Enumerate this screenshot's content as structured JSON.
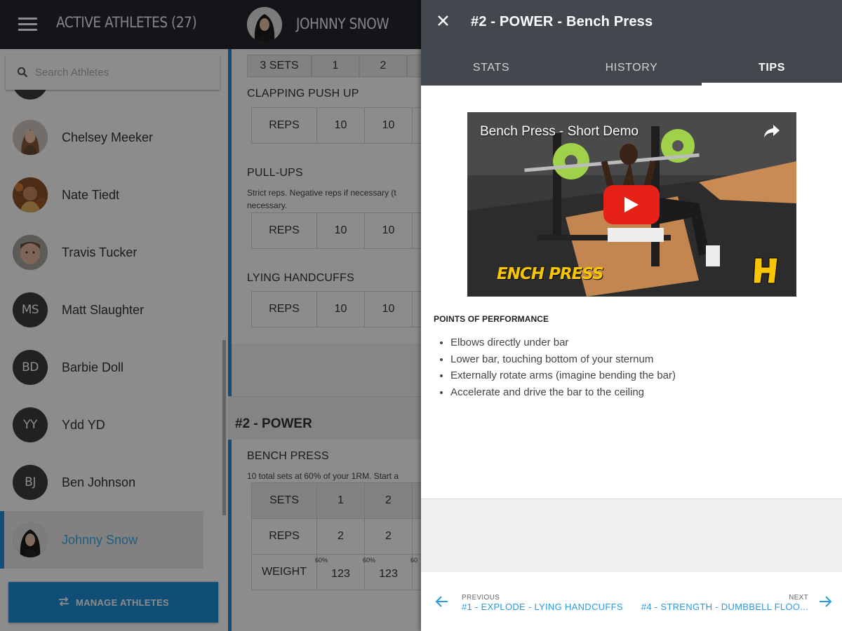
{
  "sidebar": {
    "title": "ACTIVE ATHLETES (27)",
    "search_placeholder": "Search Athletes",
    "athletes": [
      {
        "name": "Chelsey Meeker",
        "avatar": "photo",
        "initials": ""
      },
      {
        "name": "Nate Tiedt",
        "avatar": "photo",
        "initials": ""
      },
      {
        "name": "Travis Tucker",
        "avatar": "photo",
        "initials": ""
      },
      {
        "name": "Matt Slaughter",
        "avatar": "initials",
        "initials": "MS"
      },
      {
        "name": "Barbie Doll",
        "avatar": "initials",
        "initials": "BD"
      },
      {
        "name": "Ydd YD",
        "avatar": "initials",
        "initials": "YY"
      },
      {
        "name": "Ben Johnson",
        "avatar": "initials",
        "initials": "BJ"
      },
      {
        "name": "Johnny Snow",
        "avatar": "photo",
        "initials": "",
        "selected": true
      }
    ],
    "manage_label": "MANAGE ATHLETES"
  },
  "middle": {
    "athlete_name": "JOHNNY SNOW",
    "top_row": [
      "3 SETS",
      "1",
      "2"
    ],
    "exercises": [
      {
        "title": "CLAPPING PUSH UP",
        "desc": "",
        "row": [
          "REPS",
          "10",
          "10"
        ]
      },
      {
        "title": "PULL-UPS",
        "desc": "Strict reps. Negative reps if necessary (t",
        "desc2": "necessary.",
        "row": [
          "REPS",
          "10",
          "10"
        ]
      },
      {
        "title": "LYING HANDCUFFS",
        "desc": "",
        "row": [
          "REPS",
          "10",
          "10"
        ]
      }
    ],
    "section": {
      "title": "#2 - POWER",
      "exercise_title": "BENCH PRESS",
      "exercise_desc": "10 total sets at 60% of your 1RM. Start a",
      "rows": [
        [
          "SETS",
          "1",
          "2"
        ],
        [
          "REPS",
          "2",
          "2"
        ],
        [
          "WEIGHT",
          "123",
          "123"
        ]
      ],
      "pct": [
        "60%",
        "60%",
        "60"
      ]
    }
  },
  "panel": {
    "title": "#2 - POWER - Bench Press",
    "tabs": [
      "STATS",
      "HISTORY",
      "TIPS"
    ],
    "active_tab": "TIPS",
    "video": {
      "title": "Bench Press - Short Demo",
      "caption": "ENCH PRESS"
    },
    "points_heading": "POINTS OF PERFORMANCE",
    "points": [
      "Elbows directly under bar",
      "Lower bar, touching bottom of your sternum",
      "Externally rotate arms (imagine bending the bar)",
      "Accelerate and drive the bar to the ceiling"
    ],
    "prev": {
      "label": "PREVIOUS",
      "value": "#1 - EXPLODE - LYING HANDCUFFS"
    },
    "next": {
      "label": "NEXT",
      "value": "#4 - STRENGTH - DUMBBELL FLOO..."
    }
  },
  "colors": {
    "accent": "#1f8fd6",
    "header_dark": "#23272c",
    "panel_header": "#43484e",
    "play_red": "#e62117",
    "caption_yellow": "#f7c600"
  }
}
